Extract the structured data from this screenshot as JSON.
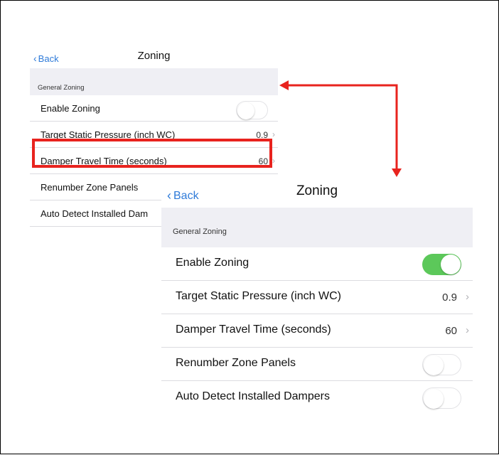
{
  "before": {
    "back_label": "Back",
    "title": "Zoning",
    "section": "General Zoning",
    "rows": [
      {
        "label": "Enable Zoning",
        "toggle": "off"
      },
      {
        "label": "Target Static Pressure (inch WC)",
        "value": "0.9"
      },
      {
        "label": "Damper Travel Time (seconds)",
        "value": "60"
      },
      {
        "label": "Renumber Zone Panels",
        "toggle": "off"
      },
      {
        "label": "Auto Detect Installed Dam"
      }
    ]
  },
  "after": {
    "back_label": "Back",
    "title": "Zoning",
    "section": "General Zoning",
    "rows": [
      {
        "label": "Enable Zoning",
        "toggle": "on"
      },
      {
        "label": "Target Static Pressure (inch WC)",
        "value": "0.9"
      },
      {
        "label": "Damper Travel Time (seconds)",
        "value": "60"
      },
      {
        "label": "Renumber Zone Panels",
        "toggle": "off"
      },
      {
        "label": "Auto Detect Installed Dampers",
        "toggle": "off"
      }
    ]
  },
  "colors": {
    "accent": "#2f7bd9",
    "toggle_on": "#5cc85a",
    "highlight": "#e8231e",
    "section_bg": "#efeff4"
  }
}
